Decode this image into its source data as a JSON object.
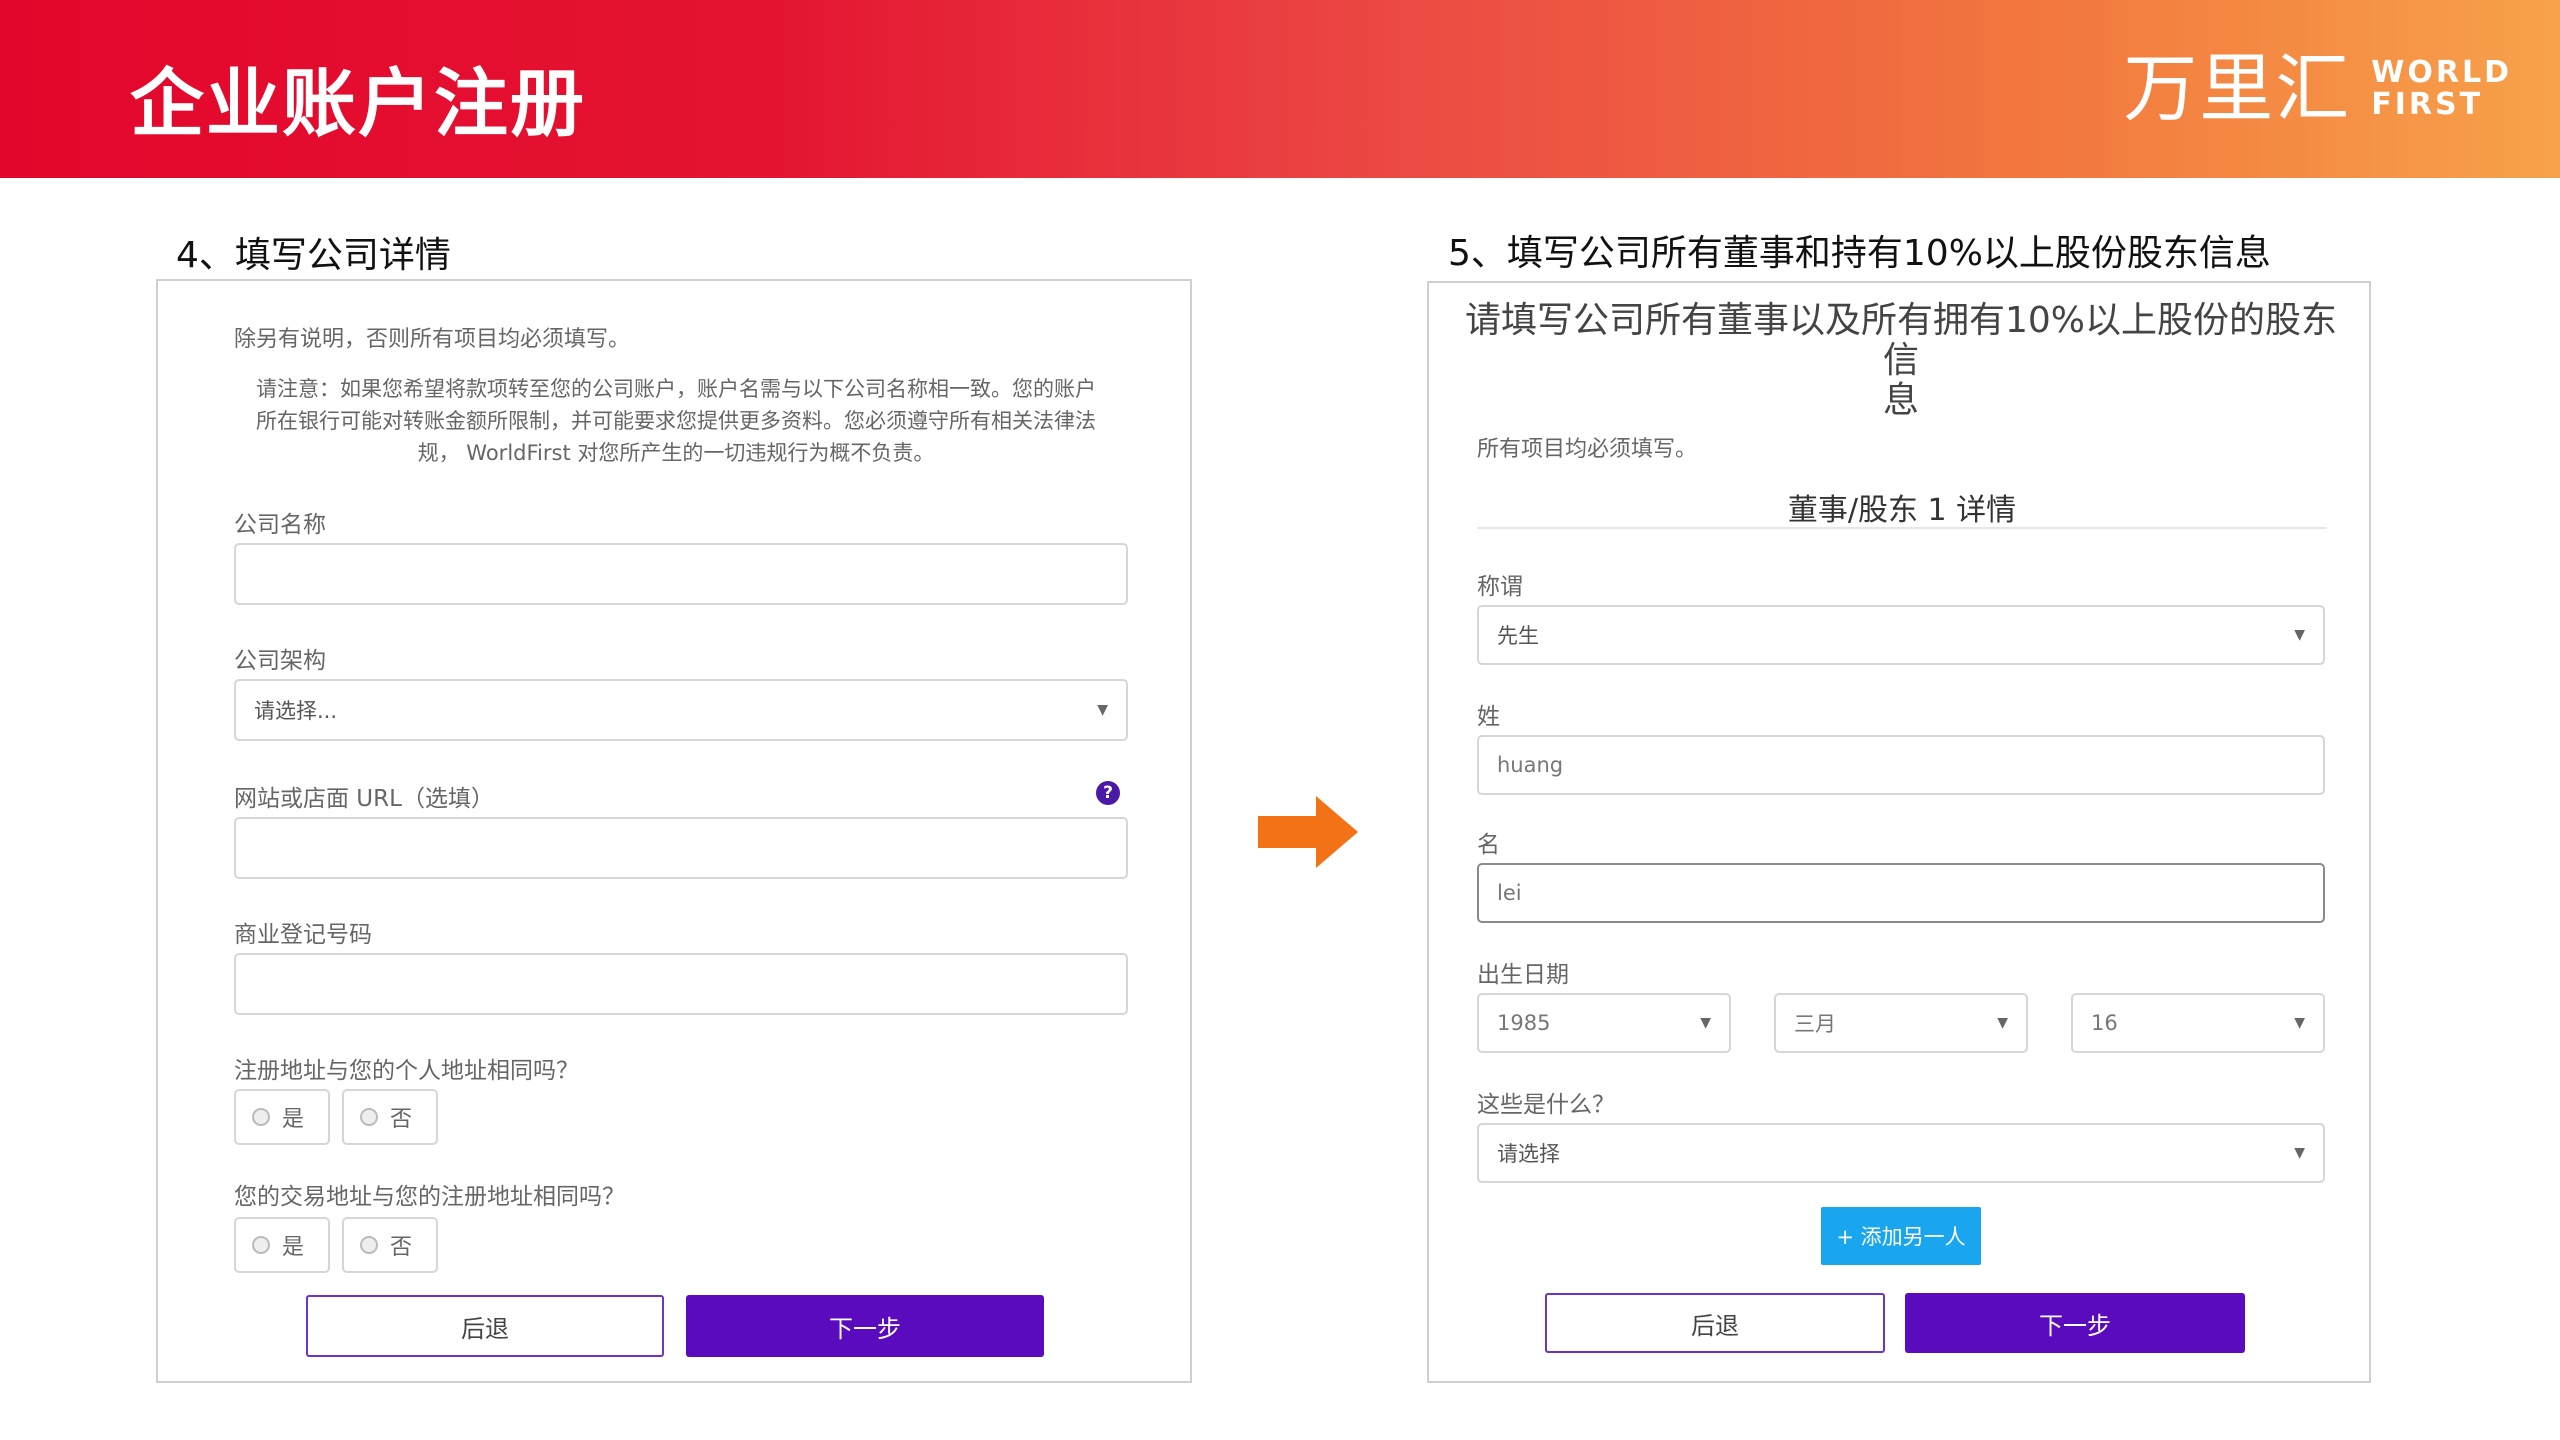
{
  "banner": {
    "title": "企业账户注册",
    "logo_cn": "万里汇",
    "logo_en_line1": "WORLD",
    "logo_en_line2": "FIRST",
    "gradient_start": "#e3062c",
    "gradient_end": "#f7a24a"
  },
  "step4": {
    "heading": "4、填写公司详情",
    "intro": "除另有说明，否则所有项目均必须填写。",
    "notice_line1": "请注意：如果您希望将款项转至您的公司账户，账户名需与以下公司名称相一致。您的账户",
    "notice_line2": "所在银行可能对转账金额所限制，并可能要求您提供更多资料。您必须遵守所有相关法律法",
    "notice_line3": "规， WorldFirst 对您所产生的一切违规行为概不负责。",
    "company_name_label": "公司名称",
    "company_name_value": "",
    "structure_label": "公司架构",
    "structure_value": "请选择...",
    "website_label": "网站或店面 URL（选填）",
    "website_value": "",
    "help_icon": "question-circle-icon",
    "reg_number_label": "商业登记号码",
    "reg_number_value": "",
    "q1_label": "注册地址与您的个人地址相同吗？",
    "q2_label": "您的交易地址与您的注册地址相同吗？",
    "yes": "是",
    "no": "否",
    "back_label": "后退",
    "next_label": "下一步"
  },
  "arrow_icon": "right-arrow-icon",
  "arrow_color": "#f47216",
  "step5": {
    "heading": "5、填写公司所有董事和持有10%以上股份股东信息",
    "form_title_line1": "请填写公司所有董事以及所有拥有10%以上股份的股东信",
    "form_title_line2": "息",
    "required_note": "所有项目均必须填写。",
    "section_title": "董事/股东 1 详情",
    "title_label": "称谓",
    "title_value": "先生",
    "surname_label": "姓",
    "surname_value": "huang",
    "given_label": "名",
    "given_value": "lei",
    "dob_label": "出生日期",
    "dob_year": "1985",
    "dob_month": "三月",
    "dob_day": "16",
    "role_label": "这些是什么？",
    "role_value": "请选择",
    "add_label": "+ 添加另一人",
    "back_label": "后退",
    "next_label": "下一步"
  },
  "colors": {
    "primary_button": "#5a0bbd",
    "back_button_border": "#6b36c8",
    "add_button": "#1aa6ee",
    "help_icon": "#4a1aa6"
  }
}
